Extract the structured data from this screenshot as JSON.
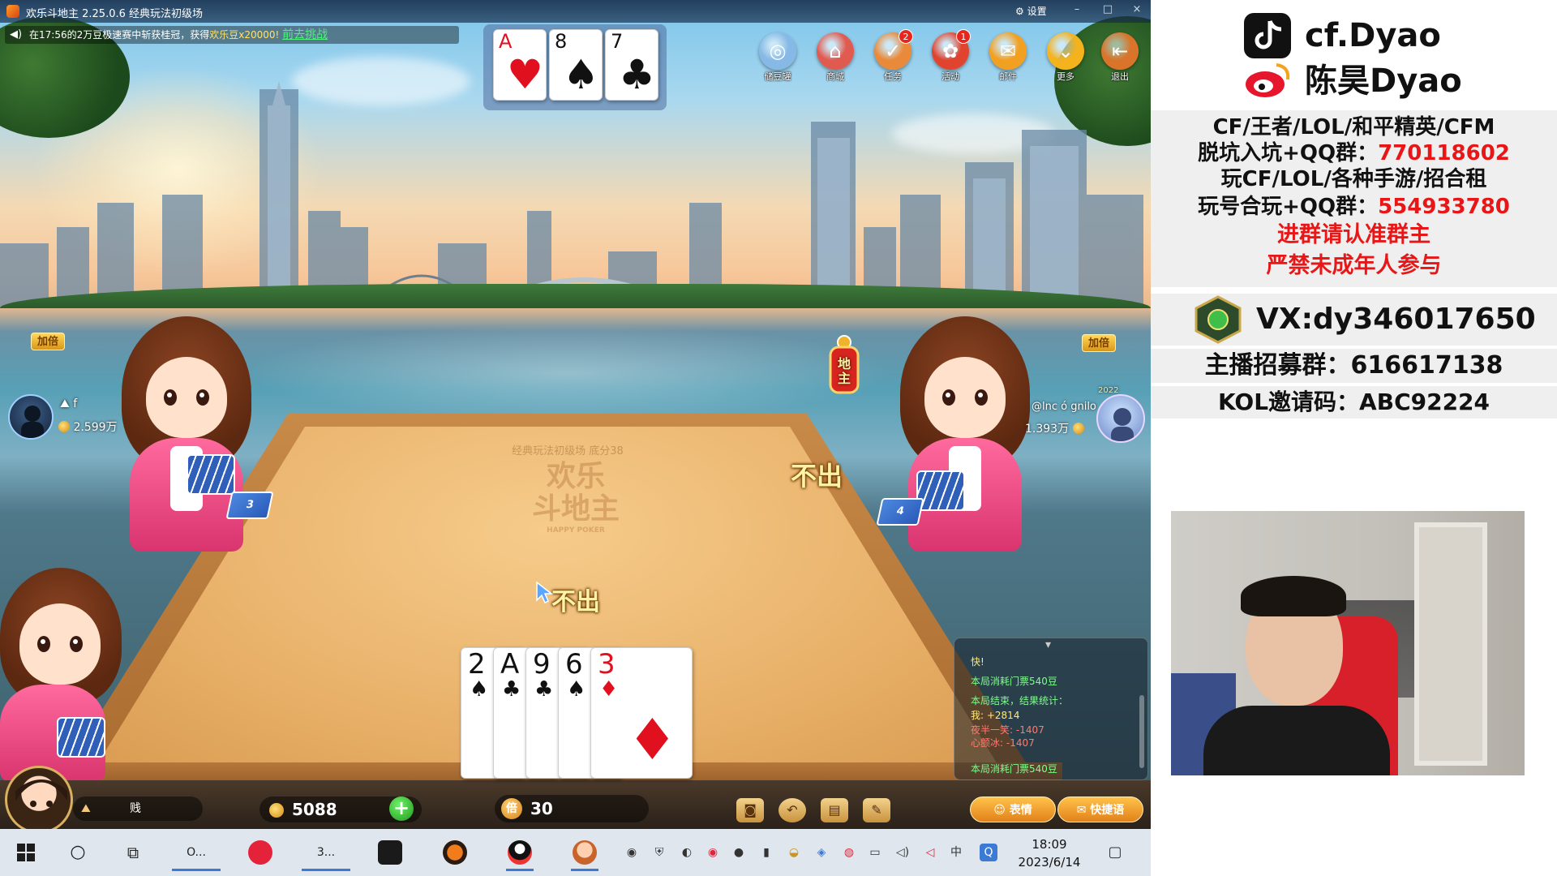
{
  "window": {
    "title": "欢乐斗地主 2.25.0.6 经典玩法初级场",
    "settings_label": "设置",
    "minimize": "–",
    "maximize": "□",
    "close": "×"
  },
  "marquee": {
    "prefix": "在17:56的2万豆极速赛中斩获桂冠，获得",
    "highlight": "欢乐豆x20000!",
    "link": "前去挑战"
  },
  "top_cards": [
    {
      "rank": "A",
      "suit": "♥",
      "color": "red"
    },
    {
      "rank": "8",
      "suit": "♠",
      "color": "black"
    },
    {
      "rank": "7",
      "suit": "♣",
      "color": "black"
    }
  ],
  "top_icons": [
    {
      "label": "储豆罐",
      "glyph": "◎",
      "color": "#86b9e6",
      "badge": ""
    },
    {
      "label": "商城",
      "glyph": "⌂",
      "color": "#e05a4f",
      "badge": ""
    },
    {
      "label": "任务",
      "glyph": "✓",
      "color": "#e98a3a",
      "badge": "2"
    },
    {
      "label": "活动",
      "glyph": "✿",
      "color": "#e0442f",
      "badge": "1"
    },
    {
      "label": "邮件",
      "glyph": "✉",
      "color": "#f2a021",
      "badge": ""
    },
    {
      "label": "更多",
      "glyph": "⌄",
      "color": "#f4b21c",
      "badge": ""
    },
    {
      "label": "退出",
      "glyph": "⇤",
      "color": "#d9742a",
      "badge": ""
    }
  ],
  "table": {
    "watermark": "经典玩法初级场 底分38",
    "logo_line1": "欢乐",
    "logo_line2": "斗地主",
    "logo_sub": "HAPPY POKER"
  },
  "left_player": {
    "double_label": "加倍",
    "name": "f",
    "coins": "2.599万",
    "cards_left": "3"
  },
  "right_player": {
    "double_label": "加倍",
    "name": "@lnc ó gnilo",
    "coins": "1.393万",
    "cards_left": "4",
    "year_badge": "2022",
    "status": "不出"
  },
  "landlord_label": "地主",
  "my_status": "不出",
  "my_hand": [
    {
      "rank": "2",
      "suit": "♠",
      "color": "black"
    },
    {
      "rank": "A",
      "suit": "♣",
      "color": "black"
    },
    {
      "rank": "9",
      "suit": "♣",
      "color": "black"
    },
    {
      "rank": "6",
      "suit": "♠",
      "color": "black"
    },
    {
      "rank": "3",
      "suit": "♦",
      "color": "red"
    }
  ],
  "chat": {
    "line1": "快!",
    "line2": "本局消耗门票540豆",
    "line3": "本局结束，结果统计：",
    "line4": "我: +2814",
    "line5": "夜半一笑: -1407",
    "line6": "心颤冰: -1407",
    "line7": "本局消耗门票540豆"
  },
  "bottom": {
    "name": "贱",
    "coins": "5088",
    "plus": "+",
    "multiplier_icon": "倍",
    "multiplier": "30",
    "emote_label": "表情",
    "quick_label": "快捷语"
  },
  "taskbar": {
    "obs_label": "O...",
    "app3_label": "3...",
    "time": "18:09",
    "date": "2023/6/14",
    "ime": "中"
  },
  "overlay": {
    "douyin": "cf.Dyao",
    "weibo": "陈昊Dyao",
    "line1": "CF/王者/LOL/和平精英/CFM",
    "line2_label": "脱坑入坑+QQ群：",
    "line2_num": "770118602",
    "line3": "玩CF/LOL/各种手游/招合租",
    "line4_label": "玩号合玩+QQ群：",
    "line4_num": "554933780",
    "line5": "进群请认准群主",
    "line6": "严禁未成年人参与",
    "vx": "VX:dy346017650",
    "recruit": "主播招募群：616617138",
    "kol": "KOL邀请码：ABC92224"
  }
}
